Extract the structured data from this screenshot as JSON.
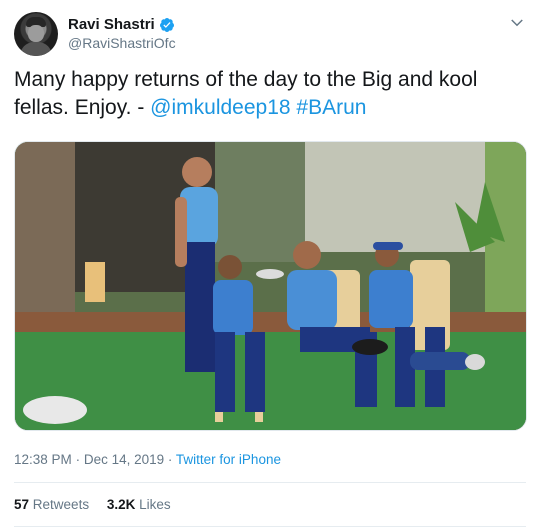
{
  "user": {
    "display_name": "Ravi Shastri",
    "handle": "@RaviShastriOfc",
    "verified": true,
    "avatar_icon": "profile-photo"
  },
  "tweet": {
    "text_plain": "Many happy returns of the day to the Big and kool fellas. Enjoy. - ",
    "mentions": [
      "@imkuldeep18"
    ],
    "hashtags": [
      "#BArun"
    ]
  },
  "photo": {
    "icon": "photo-cricket-team-seated"
  },
  "meta": {
    "time": "12:38 PM",
    "separator": "·",
    "date": "Dec 14, 2019",
    "source": "Twitter for iPhone"
  },
  "stats": {
    "retweets_count": "57",
    "retweets_label": "Retweets",
    "likes_count": "3.2K",
    "likes_label": "Likes"
  },
  "colors": {
    "link": "#1b95e0",
    "muted": "#657786",
    "text": "#14171a",
    "divider": "#e6ecf0"
  },
  "icons": {
    "verified": "verified-badge-icon",
    "menu": "chevron-down-icon"
  }
}
